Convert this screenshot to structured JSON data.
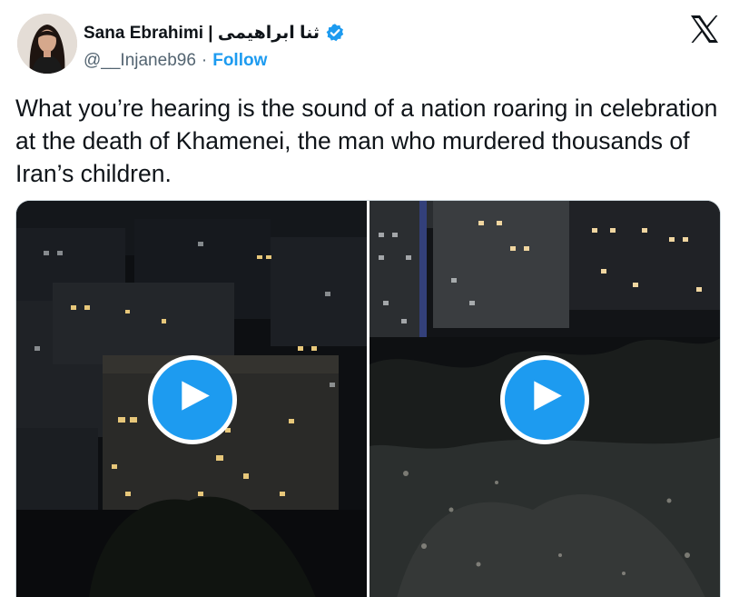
{
  "author": {
    "display_name": "Sana Ebrahimi | ثنا ابراهیمی",
    "handle": "@__Injaneb96",
    "separator": "·",
    "follow_label": "Follow",
    "verified": true
  },
  "tweet": {
    "text": "What you’re hearing is the sound of a nation roaring in celebration at the death of Khamenei, the man who murdered thousands of Iran’s children."
  },
  "media": {
    "items": [
      {
        "type": "video",
        "icon": "play-icon",
        "scene": "night city buildings with lit windows"
      },
      {
        "type": "video",
        "icon": "play-icon",
        "scene": "night apartment blocks and dark trees"
      }
    ]
  },
  "icons": {
    "platform_logo": "x-logo-icon",
    "verified": "verified-badge-icon"
  },
  "colors": {
    "accent": "#1d9bf0",
    "text_primary": "#0f1419",
    "text_secondary": "#536471"
  }
}
